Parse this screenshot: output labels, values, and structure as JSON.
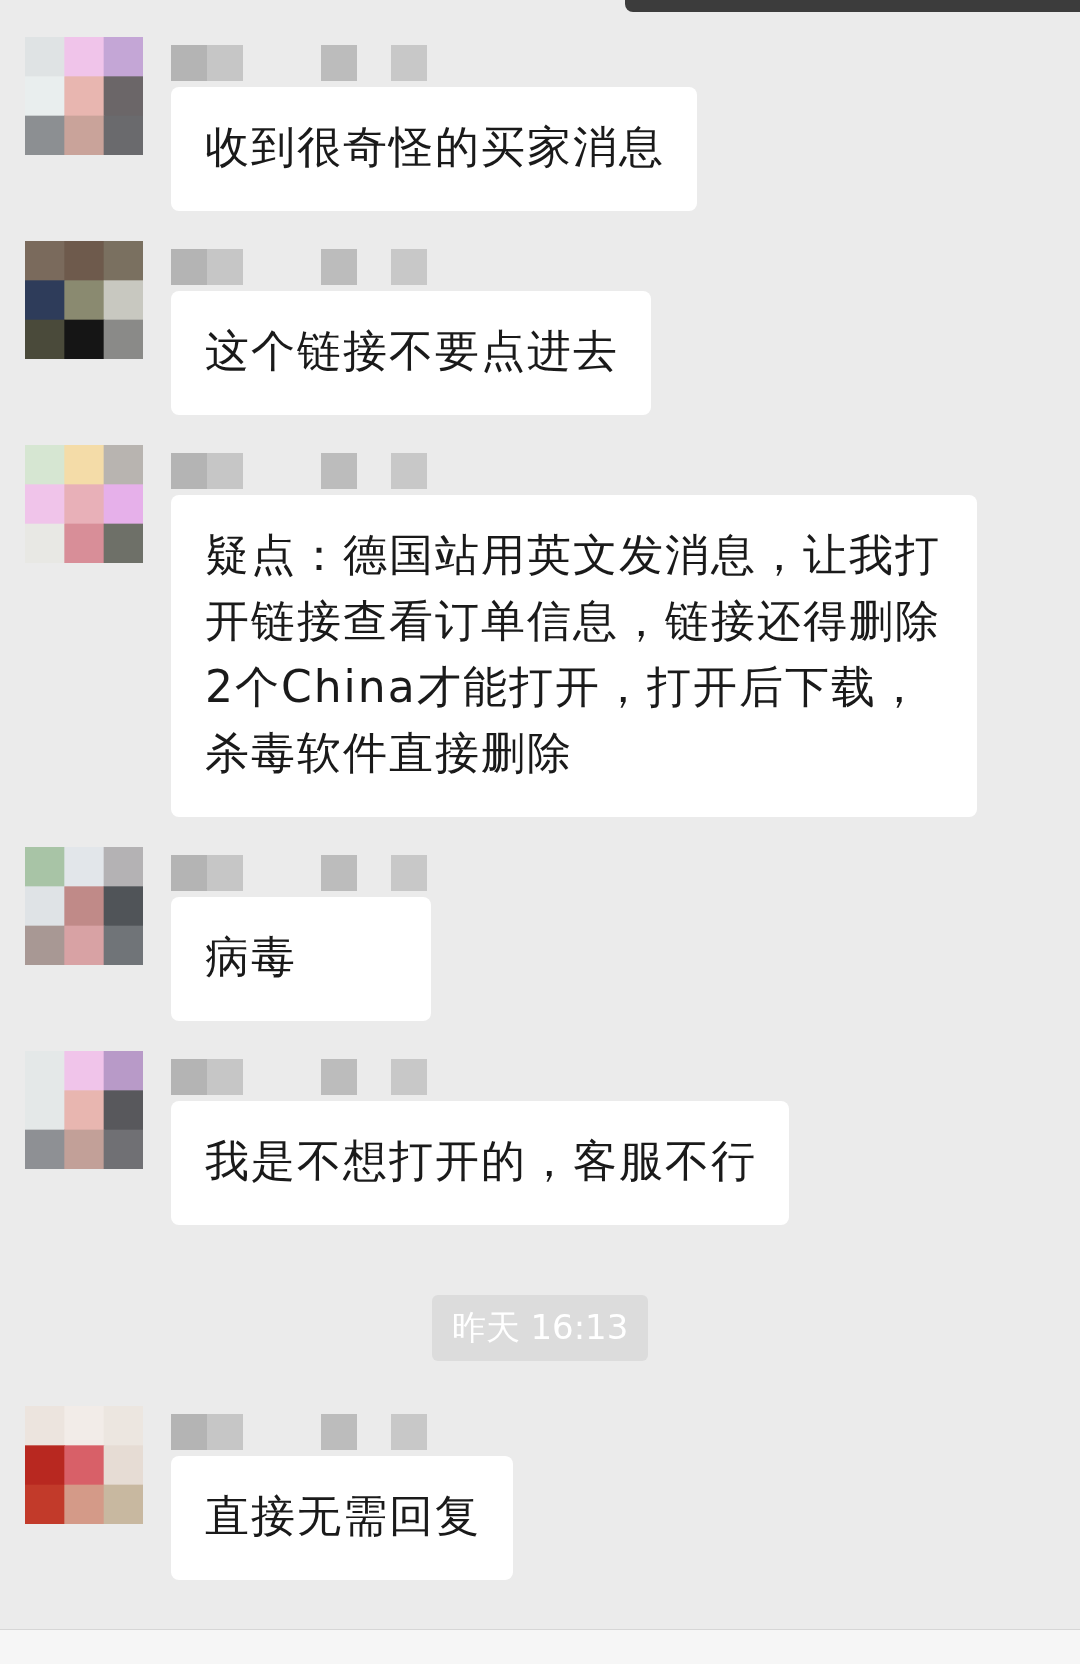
{
  "chat": [
    {
      "kind": "message",
      "text": "收到很奇怪的买家消息"
    },
    {
      "kind": "message",
      "text": "这个链接不要点进去"
    },
    {
      "kind": "message",
      "text": "疑点：德国站用英文发消息，让我打开链接查看订单信息，链接还得删除2个China才能打开，打开后下载，杀毒软件直接删除"
    },
    {
      "kind": "message",
      "text": "病毒"
    },
    {
      "kind": "message",
      "text": "我是不想打开的，客服不行"
    },
    {
      "kind": "timestamp",
      "text": "昨天 16:13"
    },
    {
      "kind": "message",
      "text": "直接无需回复"
    }
  ]
}
